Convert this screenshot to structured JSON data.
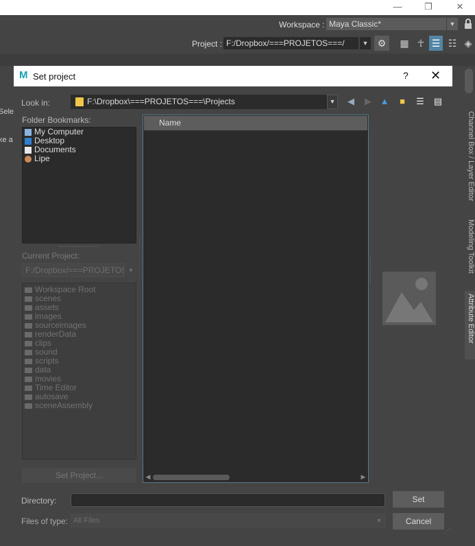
{
  "app": {
    "workspace_label": "Workspace :",
    "workspace_value": "Maya Classic*",
    "project_label": "Project :",
    "project_value": "F:/Dropbox/===PROJETOS===/",
    "left_edge_texts": [
      "Selec",
      "ke a"
    ]
  },
  "side_tabs": [
    {
      "label": "Channel Box / Layer Editor",
      "active": false
    },
    {
      "label": "Modeling Toolkit",
      "active": false
    },
    {
      "label": "Attribute Editor",
      "active": true
    }
  ],
  "dialog": {
    "title": "Set project",
    "help": "?",
    "close": "✕",
    "look_in_label": "Look in:",
    "look_in_value": "F:\\Dropbox\\===PROJETOS===\\Projects",
    "folder_bookmarks_label": "Folder Bookmarks:",
    "bookmarks": [
      {
        "label": "My Computer",
        "icon": "computer-icon"
      },
      {
        "label": "Desktop",
        "icon": "desktop-icon"
      },
      {
        "label": "Documents",
        "icon": "document-icon"
      },
      {
        "label": "Lipe",
        "icon": "user-icon"
      }
    ],
    "current_project_label": "Current Project:",
    "current_project_value": "F:/Dropbox/===PROJETOS=",
    "workspace_items": [
      "Workspace Root",
      "scenes",
      "assets",
      "images",
      "sourceimages",
      "renderData",
      "clips",
      "sound",
      "scripts",
      "data",
      "movies",
      "Time Editor",
      "autosave",
      "sceneAssembly"
    ],
    "set_project_button": "Set Project...",
    "column_name": "Name",
    "directory_label": "Directory:",
    "directory_value": "",
    "files_of_type_label": "Files of type:",
    "files_of_type_value": "All Files",
    "set_button": "Set",
    "cancel_button": "Cancel"
  },
  "colors": {
    "accent": "#5285a6",
    "folder": "#f3c64a",
    "maya_logo": "#18a0b0"
  }
}
